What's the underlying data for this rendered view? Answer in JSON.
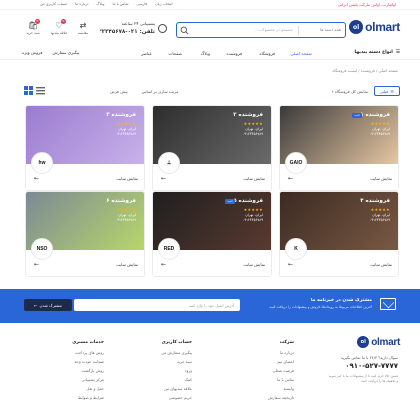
{
  "topbar": {
    "promo": "اولمارت، اولین مارکت پلیس ایرانی",
    "links": [
      "انتخاب زبان",
      "فارسی",
      "تماس با ما",
      "وبلاگ",
      "درباره ما",
      "حساب کاربری من"
    ]
  },
  "header": {
    "logo_mark": "ol",
    "logo_text": "olmart",
    "search_category": "همه دسته ها",
    "search_placeholder": "جستجو در محصولات...",
    "support_label": "پشتیبانی ۲۴ ساعته",
    "support_phone": "تلفن: ۰۲۱-۳۲۳۴۵۶۷۸",
    "icons": [
      {
        "label": "سبد خرید",
        "icon": "cart-icon",
        "badge": "0"
      },
      {
        "label": "علاقه مندیها",
        "icon": "heart-icon",
        "badge": "0"
      },
      {
        "label": "مقایسه",
        "icon": "compare-icon",
        "badge": ""
      }
    ]
  },
  "nav": {
    "categories_btn": "انواع دسته بندیها",
    "items": [
      "صفحه اصلی",
      "فروشگاه",
      "فروشنده",
      "وبلاگ",
      "صفحات",
      "عناصر"
    ],
    "left_links": [
      "پیگیری سفارش",
      "فروش ویژه"
    ]
  },
  "breadcrumb": "صفحه اصلی / فروشنده / لیست فروشگاه",
  "toolbar": {
    "filter": "فیلتر",
    "count_text": "نمایش کل فروشگاه ۶",
    "sort_label": "مرتب سازی بر اساس",
    "sort_value": "پیش فرض"
  },
  "vendors": [
    {
      "title": "فروشنده ۱",
      "stars": "★★★★★",
      "location": "ایران، تهران",
      "phone": "۰۹۱۲۳۴۵۶۷۸۹",
      "logo": "GAIO",
      "tag": "جدید",
      "visit": "نمایش سایت",
      "bg1": "#3a3a3a",
      "bg2": "#e9c9a4"
    },
    {
      "title": "فروشنده ۲",
      "stars": "★★★★★",
      "location": "ایران، تهران",
      "phone": "۰۹۱۲۳۴۵۶۷۸۹",
      "logo": "⟂",
      "tag": "",
      "visit": "نمایش سایت",
      "bg1": "#2d2d2d",
      "bg2": "#6b6b6b"
    },
    {
      "title": "فروشنده ۳",
      "stars": "★★★★★",
      "location": "ایران، تهران",
      "phone": "۰۹۱۲۳۴۵۶۷۸۹",
      "logo": "hw",
      "tag": "",
      "visit": "نمایش سایت",
      "bg1": "#9b7bd0",
      "bg2": "#c9b3ea"
    },
    {
      "title": "فروشنده ۴",
      "stars": "★★★★★",
      "location": "ایران، تهران",
      "phone": "۰۹۱۲۳۴۵۶۷۸۹",
      "logo": "K",
      "tag": "",
      "visit": "نمایش سایت",
      "bg1": "#3b2a22",
      "bg2": "#7a5a44"
    },
    {
      "title": "فروشنده ۵",
      "stars": "★★★★★",
      "location": "ایران، تهران",
      "phone": "۰۹۱۲۳۴۵۶۷۸۹",
      "logo": "RED",
      "tag": "جدید",
      "visit": "نمایش سایت",
      "bg1": "#1f1f1f",
      "bg2": "#5a3a30"
    },
    {
      "title": "فروشنده ۶",
      "stars": "★★★★★",
      "location": "ایران، تهران",
      "phone": "۰۹۱۲۳۴۵۶۷۸۹",
      "logo": "NSO",
      "tag": "",
      "visit": "نمایش سایت",
      "bg1": "#7b8a95",
      "bg2": "#b9d76a"
    }
  ],
  "newsletter": {
    "title": "مشترک شدن در خبرنامه ما",
    "subtitle": "آخرین اطلاعات مربوط به رویدادها، فروش و پیشنهادات را دریافت کنید.",
    "email_placeholder": "آدرس ایمیل خود را وارد کنید",
    "button": "مشترک شدن"
  },
  "footer": {
    "logo_mark": "ol",
    "logo_text": "olmart",
    "question": "سوال دارید؟ ۲۴/۷ با ما تماس بگیرید",
    "phone": "۰۹۱۰-۵۲۷-۷۷۷۷",
    "note": "همین حالا خرید کنید تا از پیشنهادات ما با خبر شوید و تخفیف ها را دریافت کنید.",
    "columns": [
      {
        "heading": "شرکت",
        "items": [
          "درباره ما",
          "اعضای تیم",
          "فرصت شغلی",
          "تماس با ما",
          "وابسته",
          "تاریخچه سفارش"
        ]
      },
      {
        "heading": "حساب کاربری",
        "items": [
          "پیگیری سفارش من",
          "سبد خرید",
          "ورود",
          "کمک",
          "علاقه مندیهای من",
          "حریم خصوصی"
        ]
      },
      {
        "heading": "خدمات مشتری",
        "items": [
          "روش های پرداخت",
          "ضمانت عودت وجه",
          "روش بازگشت",
          "مرکز پشتیبانی",
          "حمل و نقل",
          "شرایط و ضوابط"
        ]
      }
    ]
  }
}
